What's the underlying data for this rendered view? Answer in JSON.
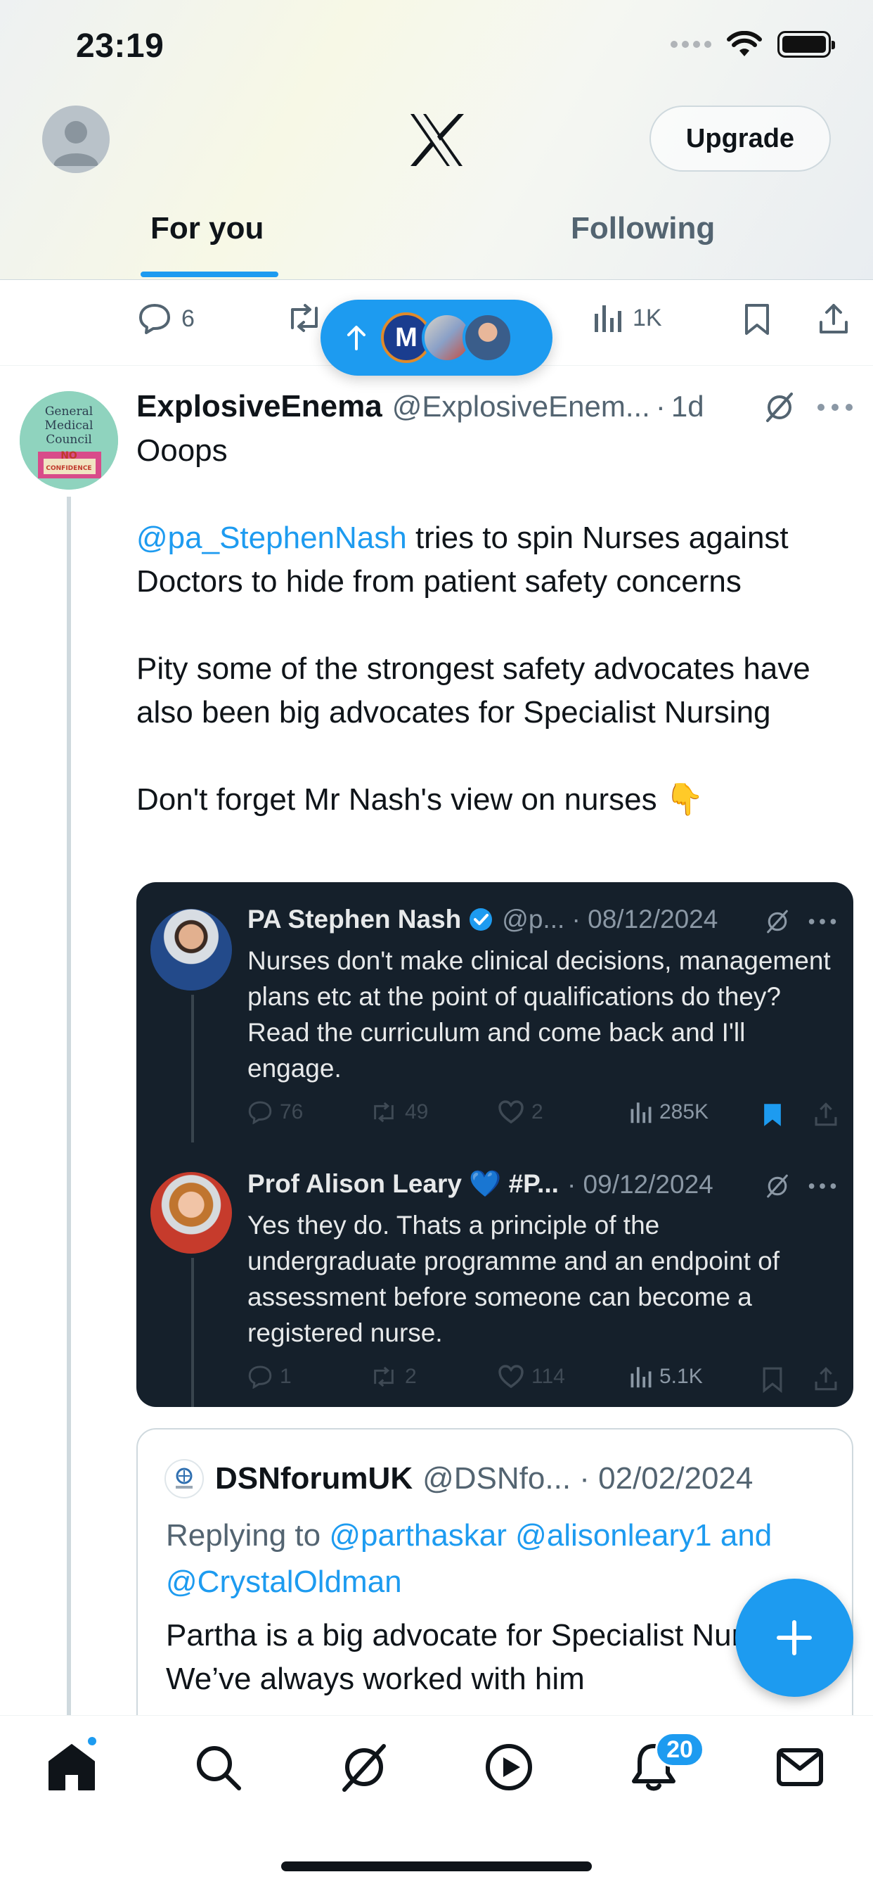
{
  "status_bar": {
    "time": "23:19"
  },
  "header": {
    "upgrade_label": "Upgrade",
    "tabs": [
      {
        "label": "For you",
        "active": true
      },
      {
        "label": "Following",
        "active": false
      }
    ]
  },
  "previous_tweet_actions": {
    "replies": "6",
    "views": "1K"
  },
  "new_posts_pill": {
    "avatar_letter": "M"
  },
  "tweet": {
    "author_name": "ExplosiveEnema",
    "author_handle": "@ExplosiveEnem...",
    "separator": "·",
    "time": "1d",
    "avatar_text": [
      "General",
      "Medical",
      "Council",
      "NO",
      "CONFIDENCE"
    ],
    "text": {
      "line1": "Ooops",
      "mention": "@pa_StephenNash",
      "line2_rest": " tries to spin Nurses against Doctors to hide from patient safety concerns",
      "line3": "Pity some of the strongest safety advocates have also been big advocates for Specialist Nursing",
      "line4": "Don't forget Mr Nash's view on nurses 👇"
    }
  },
  "embedded_image": {
    "tweets": [
      {
        "name": "PA Stephen Nash",
        "meta": "@p... · 08/12/2024",
        "text": "Nurses don't make clinical decisions, management plans etc at the point of qualifications do they? Read the curriculum and come back and I'll engage.",
        "replies": "76",
        "reposts": "49",
        "likes": "2",
        "views": "285K"
      },
      {
        "name": "Prof Alison Leary 💙 #P...",
        "meta": "· 09/12/2024",
        "text": "Yes they do. Thats a principle of the undergraduate programme and an endpoint of assessment before someone can become a registered nurse.",
        "replies": "1",
        "reposts": "2",
        "likes": "114",
        "views": "5.1K"
      }
    ]
  },
  "quoted_tweet": {
    "name": "DSNforumUK",
    "meta": "@DSNfo... · 02/02/2024",
    "replying_prefix": "Replying to",
    "replying_to": "@parthaskar @alisonleary1 and @CrystalOldman",
    "text": "Partha is a big advocate for Specialist Nursing! We’ve always worked with him"
  },
  "bottom_nav": {
    "items": [
      "home-icon",
      "search-icon",
      "grok-icon",
      "video-icon",
      "notifications-icon",
      "messages-icon"
    ],
    "notification_count": "20"
  },
  "colors": {
    "accent": "#1d9bf0",
    "text_primary": "#0f1419",
    "text_secondary": "#536471",
    "dark_card": "#15202b"
  }
}
